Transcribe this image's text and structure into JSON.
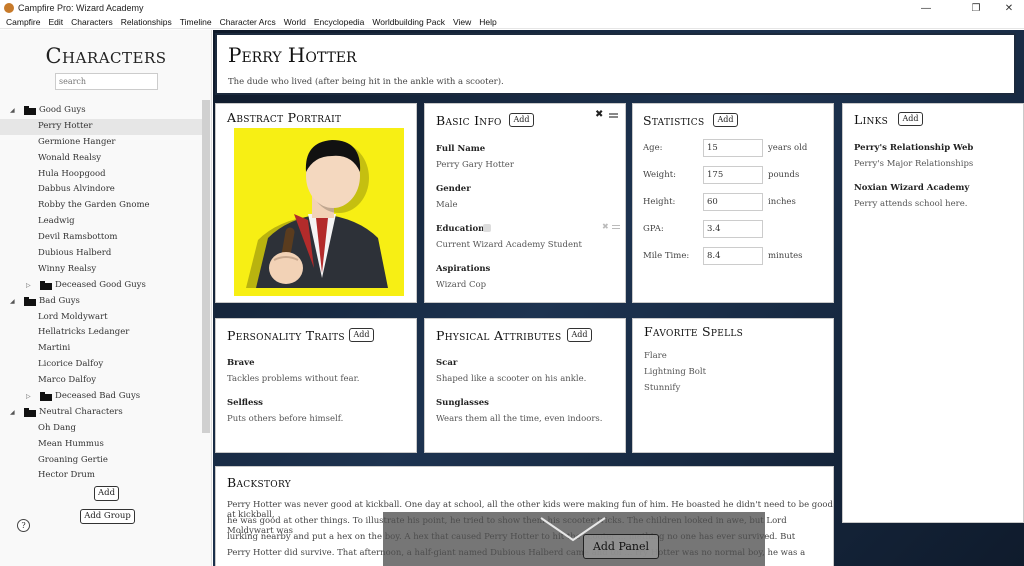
{
  "window": {
    "title": "Campfire Pro: Wizard Academy",
    "controls": [
      "—",
      "❐",
      "✕"
    ]
  },
  "menu": [
    "Campfire",
    "Edit",
    "Characters",
    "Relationships",
    "Timeline",
    "Character Arcs",
    "World",
    "Encyclopedia",
    "Worldbuilding Pack",
    "View",
    "Help"
  ],
  "sidebar": {
    "title": "Characters",
    "search_placeholder": "search",
    "tree": [
      {
        "label": "Good Guys",
        "kind": "folder",
        "level": 0,
        "expanded": true
      },
      {
        "label": "Perry Hotter",
        "kind": "item",
        "level": 1,
        "selected": true
      },
      {
        "label": "Germione Hanger",
        "kind": "item",
        "level": 1
      },
      {
        "label": "Wonald Realsy",
        "kind": "item",
        "level": 1
      },
      {
        "label": "Hula Hoopgood",
        "kind": "item",
        "level": 1
      },
      {
        "label": "Dabbus Alvindore",
        "kind": "item",
        "level": 1
      },
      {
        "label": "Robby the Garden Gnome",
        "kind": "item",
        "level": 1
      },
      {
        "label": "Leadwig",
        "kind": "item",
        "level": 1
      },
      {
        "label": "Devil Ramsbottom",
        "kind": "item",
        "level": 1
      },
      {
        "label": "Dubious Halberd",
        "kind": "item",
        "level": 1
      },
      {
        "label": "Winny Realsy",
        "kind": "item",
        "level": 1
      },
      {
        "label": "Deceased Good Guys",
        "kind": "folder",
        "level": 1,
        "expanded": false
      },
      {
        "label": "Bad Guys",
        "kind": "folder",
        "level": 0,
        "expanded": true
      },
      {
        "label": "Lord Moldywart",
        "kind": "item",
        "level": 1
      },
      {
        "label": "Hellatricks Ledanger",
        "kind": "item",
        "level": 1
      },
      {
        "label": "Martini",
        "kind": "item",
        "level": 1
      },
      {
        "label": "Licorice Dalfoy",
        "kind": "item",
        "level": 1
      },
      {
        "label": "Marco Dalfoy",
        "kind": "item",
        "level": 1
      },
      {
        "label": "Deceased Bad Guys",
        "kind": "folder",
        "level": 1,
        "expanded": false
      },
      {
        "label": "Neutral Characters",
        "kind": "folder",
        "level": 0,
        "expanded": true
      },
      {
        "label": "Oh Dang",
        "kind": "item",
        "level": 1
      },
      {
        "label": "Mean Hummus",
        "kind": "item",
        "level": 1
      },
      {
        "label": "Groaning Gertie",
        "kind": "item",
        "level": 1
      },
      {
        "label": "Hector Drum",
        "kind": "item",
        "level": 1
      }
    ],
    "add_label": "Add",
    "add_group_label": "Add Group",
    "help_label": "?"
  },
  "header": {
    "name": "Perry Hotter",
    "tagline": "The dude who lived (after being hit in the ankle with a scooter)."
  },
  "portrait": {
    "title": "Abstract Portrait"
  },
  "basic_info": {
    "title": "Basic Info",
    "add": "Add",
    "fields": [
      {
        "label": "Full Name",
        "value": "Perry Gary Hotter"
      },
      {
        "label": "Gender",
        "value": "Male"
      },
      {
        "label": "Education",
        "value": "Current Wizard Academy Student"
      },
      {
        "label": "Aspirations",
        "value": "Wizard Cop"
      }
    ]
  },
  "statistics": {
    "title": "Statistics",
    "add": "Add",
    "rows": [
      {
        "label": "Age:",
        "value": "15",
        "unit": "years old"
      },
      {
        "label": "Weight:",
        "value": "175",
        "unit": "pounds"
      },
      {
        "label": "Height:",
        "value": "60",
        "unit": "inches"
      },
      {
        "label": "GPA:",
        "value": "3.4",
        "unit": ""
      },
      {
        "label": "Mile Time:",
        "value": "8.4",
        "unit": "minutes"
      }
    ]
  },
  "links": {
    "title": "Links",
    "add": "Add",
    "items": [
      {
        "title": "Perry's Relationship Web",
        "desc": "Perry's Major Relationships"
      },
      {
        "title": "Noxian Wizard Academy",
        "desc": "Perry attends school here."
      }
    ]
  },
  "personality": {
    "title": "Personality Traits",
    "add": "Add",
    "items": [
      {
        "label": "Brave",
        "value": "Tackles problems without fear."
      },
      {
        "label": "Selfless",
        "value": "Puts others before himself."
      }
    ]
  },
  "physical": {
    "title": "Physical Attributes",
    "add": "Add",
    "items": [
      {
        "label": "Scar",
        "value": "Shaped like a scooter on his ankle."
      },
      {
        "label": "Sunglasses",
        "value": "Wears them all the time, even indoors."
      }
    ]
  },
  "spells": {
    "title": "Favorite Spells",
    "items": [
      "Flare",
      "Lightning Bolt",
      "Stunnify"
    ]
  },
  "backstory": {
    "title": "Backstory",
    "lines": [
      "Perry Hotter was never good at kickball. One day at school, all the other kids were making fun of him. He boasted he didn't need to be good at kickball,",
      "he was good at other things. To illustrate his point, he tried to show them his scooter tricks. The children looked in awe, but Lord Moldywart was",
      "lurking nearby and put a hex on the boy. A hex that caused Perry Hotter to hit the scooter ... mething no one has ever survived. But",
      "Perry Hotter did survive. That afternoon, a half-giant named Dubious Halberd came and tol ... rry Hotter was no normal boy, he was a"
    ]
  },
  "overlay": {
    "add_panel_label": "Add Panel"
  }
}
